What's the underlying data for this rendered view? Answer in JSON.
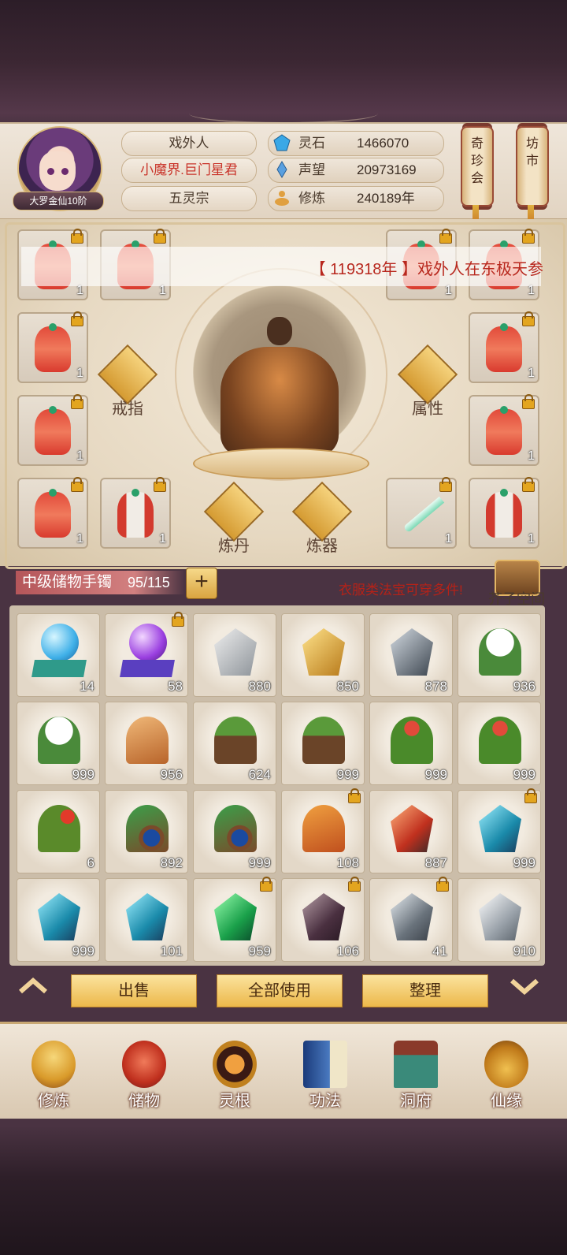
{
  "player": {
    "name": "戏外人",
    "realm": "小魔界.巨门星君",
    "sect": "五灵宗",
    "rank": "大罗金仙10阶"
  },
  "resources": [
    {
      "label": "灵石",
      "value": "1466070",
      "icon": "spirit-stone-icon",
      "color": "#3aa8e6"
    },
    {
      "label": "声望",
      "value": "20973169",
      "icon": "prestige-crystal-icon",
      "color": "#5aa0e0"
    },
    {
      "label": "修炼",
      "value": "240189年",
      "icon": "meditation-icon",
      "color": "#e0a040"
    }
  ],
  "side_menu": {
    "treasure": "奇珍会",
    "market": "坊市"
  },
  "notice": "【 119318年 】戏外人在东极天参",
  "equipment": {
    "left": [
      {
        "count": "1",
        "type": "robe"
      },
      {
        "count": "1",
        "type": "robe"
      },
      {
        "count": "1",
        "type": "robe"
      },
      {
        "count": "1",
        "type": "robe"
      },
      {
        "count": "1",
        "type": "robe"
      },
      {
        "count": "1",
        "type": "robe-white"
      }
    ],
    "right": [
      {
        "count": "1",
        "type": "robe"
      },
      {
        "count": "1",
        "type": "robe"
      },
      {
        "count": "1",
        "type": "robe"
      },
      {
        "count": "1",
        "type": "robe"
      },
      {
        "count": "1",
        "type": "sword"
      },
      {
        "count": "1",
        "type": "robe-white"
      }
    ],
    "actions": {
      "ring": "戒指",
      "attributes": "属性",
      "alchemy": "炼丹",
      "forge": "炼器"
    }
  },
  "storage": {
    "title": "中级储物手镯",
    "count": "95/115",
    "add_label": "+",
    "tip": "衣服类法宝可穿多件!",
    "space_label": "芥子空间"
  },
  "items": [
    {
      "count": "14",
      "kind": "blue-orb",
      "locked": false
    },
    {
      "count": "58",
      "kind": "purple-orb",
      "locked": true
    },
    {
      "count": "880",
      "kind": "silver-ore",
      "locked": false
    },
    {
      "count": "850",
      "kind": "gold-ore",
      "locked": false
    },
    {
      "count": "878",
      "kind": "dark-ore",
      "locked": false
    },
    {
      "count": "936",
      "kind": "white-flower",
      "locked": false
    },
    {
      "count": "999",
      "kind": "white-flower",
      "locked": false
    },
    {
      "count": "956",
      "kind": "ginseng",
      "locked": false
    },
    {
      "count": "624",
      "kind": "root-herb",
      "locked": false
    },
    {
      "count": "999",
      "kind": "root-herb",
      "locked": false
    },
    {
      "count": "999",
      "kind": "green-herb",
      "locked": false
    },
    {
      "count": "999",
      "kind": "green-herb",
      "locked": false
    },
    {
      "count": "6",
      "kind": "red-herb",
      "locked": false
    },
    {
      "count": "892",
      "kind": "berry-branch",
      "locked": false
    },
    {
      "count": "999",
      "kind": "berry-branch",
      "locked": false
    },
    {
      "count": "108",
      "kind": "cordyceps",
      "locked": true
    },
    {
      "count": "887",
      "kind": "red-crystal",
      "locked": false
    },
    {
      "count": "999",
      "kind": "teal-crystal",
      "locked": true
    },
    {
      "count": "999",
      "kind": "teal-crystal",
      "locked": false
    },
    {
      "count": "101",
      "kind": "teal-crystal",
      "locked": false
    },
    {
      "count": "959",
      "kind": "green-crystal",
      "locked": true
    },
    {
      "count": "106",
      "kind": "dark-crystal",
      "locked": true
    },
    {
      "count": "41",
      "kind": "grey-crystal",
      "locked": true
    },
    {
      "count": "910",
      "kind": "silver-crystal",
      "locked": false
    }
  ],
  "actions": {
    "sell": "出售",
    "use_all": "全部使用",
    "sort": "整理"
  },
  "nav": [
    {
      "label": "修炼",
      "icon": "cultivate-icon"
    },
    {
      "label": "储物",
      "icon": "storage-bag-icon"
    },
    {
      "label": "灵根",
      "icon": "spirit-root-icon"
    },
    {
      "label": "功法",
      "icon": "technique-book-icon"
    },
    {
      "label": "洞府",
      "icon": "cave-dwelling-icon"
    },
    {
      "label": "仙缘",
      "icon": "immortal-fate-icon"
    }
  ]
}
